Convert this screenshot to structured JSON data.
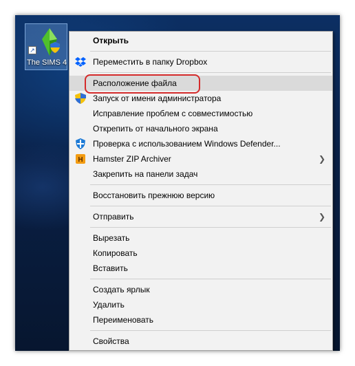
{
  "desktop": {
    "icon_label": "The SIMS 4"
  },
  "menu": {
    "open": "Открыть",
    "dropbox": "Переместить в папку Dropbox",
    "file_location": "Расположение файла",
    "run_as_admin": "Запуск от имени администратора",
    "compat": "Исправление проблем с совместимостью",
    "unpin_start": "Открепить от начального экрана",
    "defender": "Проверка с использованием Windows Defender...",
    "hamster": "Hamster ZIP Archiver",
    "pin_taskbar": "Закрепить на панели задач",
    "restore": "Восстановить прежнюю версию",
    "send_to": "Отправить",
    "cut": "Вырезать",
    "copy": "Копировать",
    "paste": "Вставить",
    "create_shortcut": "Создать ярлык",
    "delete": "Удалить",
    "rename": "Переименовать",
    "properties": "Свойства"
  },
  "colors": {
    "highlight": "#dadada",
    "callout": "#d42a2a",
    "dropbox": "#0061fe"
  }
}
